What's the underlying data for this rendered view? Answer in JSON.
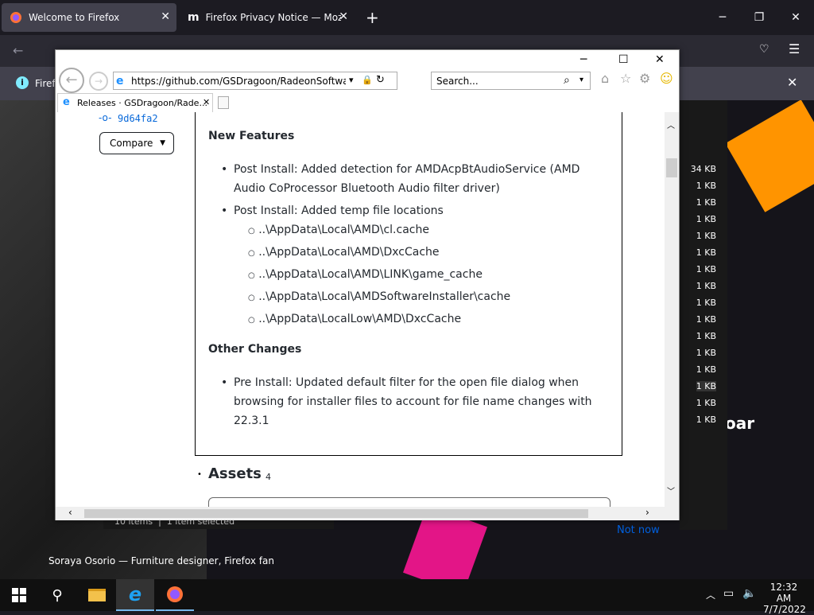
{
  "firefox": {
    "tabs": [
      {
        "title": "Welcome to Firefox"
      },
      {
        "title": "Firefox Privacy Notice — Mozilla"
      }
    ],
    "new_tab": "+",
    "infobar_text": "Firef",
    "footer_credit": "Soraya Osorio — Furniture designer, Firefox fan",
    "not_now": "Not now",
    "partial_bar": "oar"
  },
  "explorer": {
    "sizes": [
      "34 KB",
      "1 KB",
      "1 KB",
      "1 KB",
      "1 KB",
      "1 KB",
      "1 KB",
      "1 KB",
      "1 KB",
      "1 KB",
      "1 KB",
      "1 KB",
      "1 KB",
      "1 KB",
      "1 KB",
      "1 KB"
    ],
    "status_items": "10 items",
    "status_selected": "1 item selected"
  },
  "ie": {
    "address": "https://github.com/GSDragoon/RadeonSoftwareSlimmer/re",
    "search_placeholder": "Search...",
    "tab_title": "Releases · GSDragoon/Rade...",
    "commit": "9d64fa2",
    "compare": "Compare",
    "new_features_heading": "New Features",
    "new_features": [
      "Post Install: Added detection for AMDAcpBtAudioService (AMD Audio CoProcessor Bluetooth Audio filter driver)",
      "Post Install: Added temp file locations"
    ],
    "temp_paths": [
      "..\\AppData\\Local\\AMD\\cl.cache",
      "..\\AppData\\Local\\AMD\\DxcCache",
      "..\\AppData\\Local\\AMD\\LINK\\game_cache",
      "..\\AppData\\Local\\AMDSoftwareInstaller\\cache",
      "..\\AppData\\LocalLow\\AMD\\DxcCache"
    ],
    "other_changes_heading": "Other Changes",
    "other_changes": [
      "Pre Install: Updated default filter for the open file dialog when browsing for installer files to account for file name changes with 22.3.1"
    ],
    "assets_heading": "Assets",
    "assets_count": "4"
  },
  "taskbar": {
    "time": "12:32 AM",
    "date": "7/7/2022"
  }
}
